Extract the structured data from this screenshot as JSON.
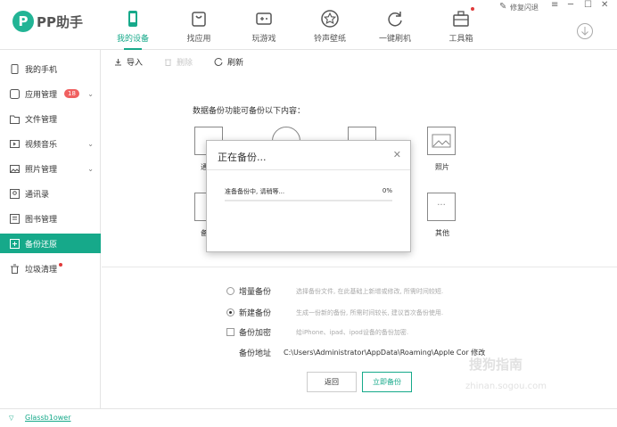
{
  "app": {
    "name": "PP助手",
    "logo_letter": "P"
  },
  "nav": {
    "tabs": [
      {
        "label": "我的设备",
        "icon": "phone-icon",
        "active": true
      },
      {
        "label": "找应用",
        "icon": "bag-icon",
        "active": false
      },
      {
        "label": "玩游戏",
        "icon": "gamepad-icon",
        "active": false
      },
      {
        "label": "铃声壁纸",
        "icon": "star-icon",
        "active": false
      },
      {
        "label": "一键刷机",
        "icon": "refresh-icon",
        "active": false
      },
      {
        "label": "工具箱",
        "icon": "toolbox-icon",
        "active": false
      }
    ]
  },
  "window": {
    "feedback_label": "修复闪退"
  },
  "sidebar": {
    "items": [
      {
        "label": "我的手机",
        "icon": "phone-icon"
      },
      {
        "label": "应用管理",
        "icon": "app-icon",
        "badge": "18"
      },
      {
        "label": "文件管理",
        "icon": "folder-icon"
      },
      {
        "label": "视频音乐",
        "icon": "video-icon"
      },
      {
        "label": "照片管理",
        "icon": "photo-icon"
      },
      {
        "label": "通讯录",
        "icon": "contacts-icon"
      },
      {
        "label": "图书管理",
        "icon": "book-icon"
      },
      {
        "label": "备份还原",
        "icon": "backup-icon",
        "active": true
      },
      {
        "label": "垃圾清理",
        "icon": "trash-icon"
      }
    ]
  },
  "toolbar": {
    "import": "导入",
    "delete": "删除",
    "refresh": "刷新"
  },
  "main": {
    "intro": "数据备份功能可备份以下内容：",
    "categories": [
      {
        "label": "通"
      },
      {
        "label": ""
      },
      {
        "label": ""
      },
      {
        "label": "照片"
      },
      {
        "label": "备"
      },
      {
        "label": "其他"
      }
    ]
  },
  "options": {
    "incremental": {
      "label": "增量备份",
      "desc": "选择备份文件, 在此基础上新增或修改, 所需时间较短.",
      "selected": false
    },
    "new_backup": {
      "label": "新建备份",
      "desc": "生成一份新的备份, 所需时间较长, 建议首次备份使用.",
      "selected": true
    },
    "encrypt": {
      "label": "备份加密",
      "desc": "给iPhone、ipad、ipod设备的备份加密.",
      "checked": false
    },
    "address_label": "备份地址",
    "address_value": "C:\\Users\\Administrator\\AppData\\Roaming\\Apple Cor 修改"
  },
  "buttons": {
    "back": "返回",
    "start": "立即备份"
  },
  "dialog": {
    "title": "正在备份...",
    "status": "准备备份中, 请稍等...",
    "percent_text": "0%",
    "progress": 0
  },
  "footer": {
    "user": "Glassb1ower"
  },
  "watermark": {
    "line1": "搜狗指南",
    "line2": "zhinan.sogou.com"
  },
  "colors": {
    "accent": "#16a98a",
    "badge": "#f06060"
  }
}
